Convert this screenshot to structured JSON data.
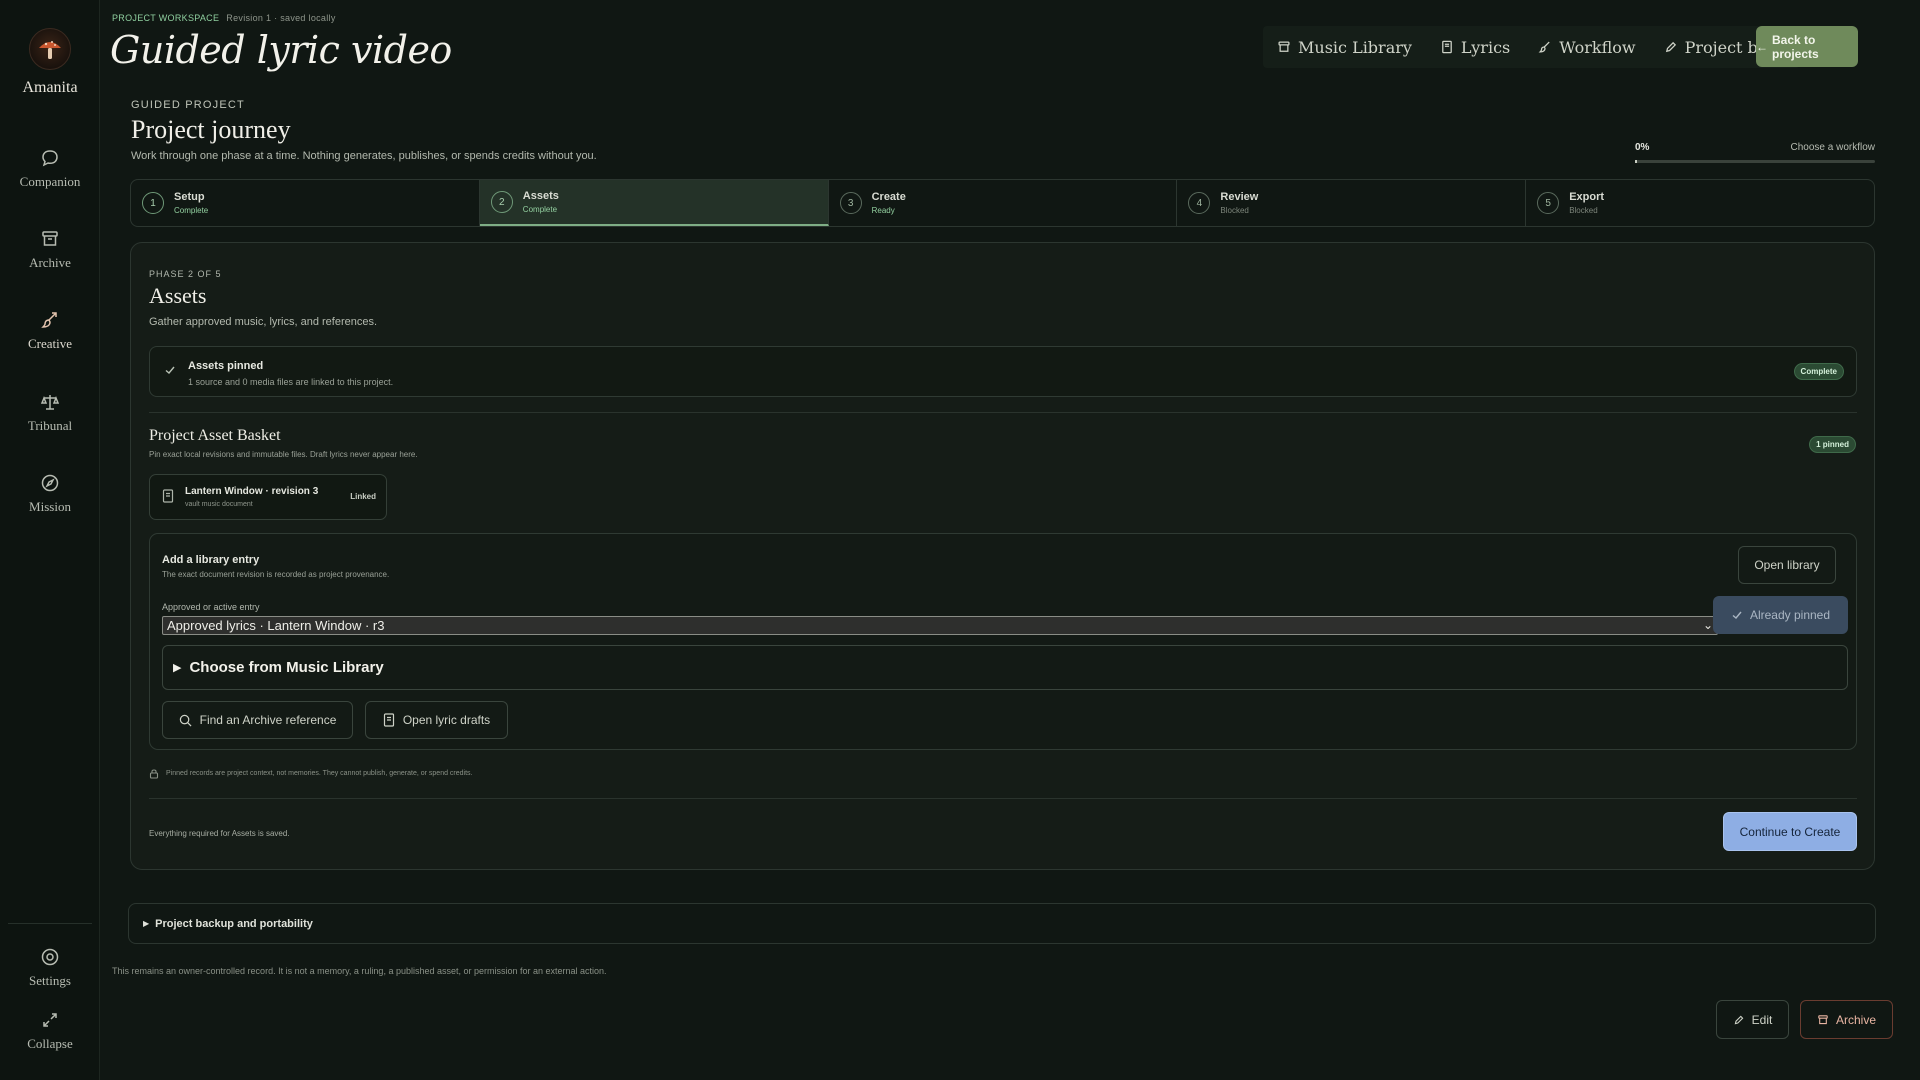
{
  "sidebar": {
    "brand": "Amanita",
    "items": [
      {
        "label": "Companion",
        "icon": "chat-icon"
      },
      {
        "label": "Archive",
        "icon": "archive-icon"
      },
      {
        "label": "Creative",
        "icon": "brush-icon",
        "active": true
      },
      {
        "label": "Tribunal",
        "icon": "scales-icon"
      },
      {
        "label": "Mission",
        "icon": "compass-icon"
      }
    ],
    "settings": "Settings",
    "collapse": "Collapse"
  },
  "header": {
    "workspace": "PROJECT WORKSPACE",
    "revision": "Revision 1 · saved locally",
    "title": "Guided lyric video",
    "nav": [
      "Music Library",
      "Lyrics",
      "Workflow",
      "Project brief"
    ],
    "back": "Back to projects"
  },
  "journey": {
    "eyebrow": "GUIDED PROJECT",
    "title": "Project journey",
    "subtitle": "Work through one phase at a time. Nothing generates, publishes, or spends credits without you.",
    "progress_label": "0%",
    "progress_value": 0,
    "progress_hint": "Choose a workflow",
    "steps": [
      {
        "num": "1",
        "name": "Setup",
        "status": "Complete"
      },
      {
        "num": "2",
        "name": "Assets",
        "status": "Complete"
      },
      {
        "num": "3",
        "name": "Create",
        "status": "Ready"
      },
      {
        "num": "4",
        "name": "Review",
        "status": "Blocked"
      },
      {
        "num": "5",
        "name": "Export",
        "status": "Blocked"
      }
    ]
  },
  "phase": {
    "eyebrow": "PHASE 2 OF 5",
    "title": "Assets",
    "subtitle": "Gather approved music, lyrics, and references.",
    "pinned": {
      "title": "Assets pinned",
      "detail": "1 source and 0 media files are linked to this project.",
      "badge": "Complete"
    },
    "basket": {
      "title": "Project Asset Basket",
      "subtitle": "Pin exact local revisions and immutable files. Draft lyrics never appear here.",
      "count": "1 pinned",
      "item_title": "Lantern Window · revision 3",
      "item_sub": "vault music document",
      "item_status": "Linked"
    },
    "library": {
      "title": "Add a library entry",
      "subtitle": "The exact document revision is recorded as project provenance.",
      "open": "Open library",
      "field_label": "Approved or active entry",
      "selected": "Approved lyrics · Lantern Window · r3",
      "pinned_btn": "Already pinned",
      "choose": "Choose from Music Library",
      "find": "Find an Archive reference",
      "drafts": "Open lyric drafts"
    },
    "note": "Pinned records are project context, not memories. They cannot publish, generate, or spend credits.",
    "saved": "Everything required for Assets is saved.",
    "continue": "Continue to Create"
  },
  "backup": "Project backup and portability",
  "footer_note": "This remains an owner-controlled record. It is not a memory, a ruling, a published asset, or permission for an external action.",
  "actions": {
    "edit": "Edit",
    "archive": "Archive"
  }
}
